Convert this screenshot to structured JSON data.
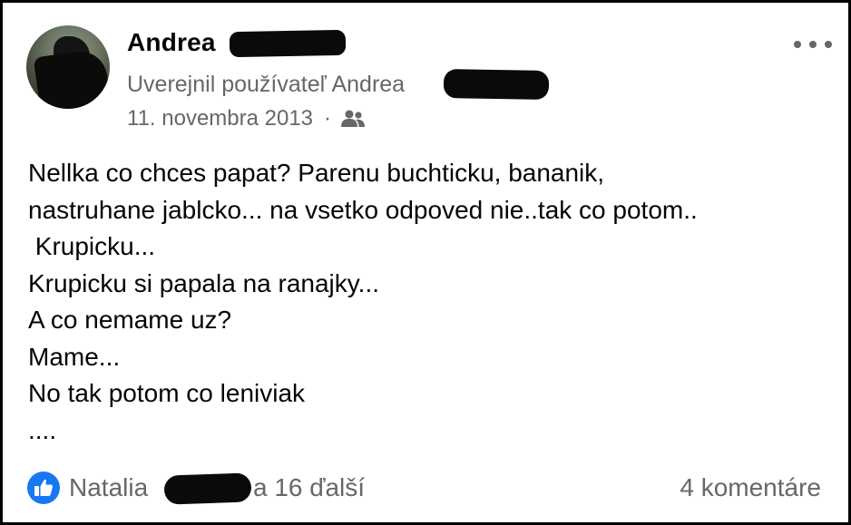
{
  "post": {
    "author_first_name": "Andrea",
    "posted_by_prefix": "Uverejnil používateľ Andrea",
    "date": "11. novembra 2013",
    "separator": "·",
    "audience_icon": "friends-icon",
    "more_icon": "more-options-icon",
    "body_lines": [
      "Nellka co chces papat? Parenu buchticku, bananik,",
      "nastruhane jablcko... na vsetko odpoved nie..tak co potom..",
      " Krupicku...",
      "Krupicku si papala na ranajky...",
      "A co nemame uz?",
      "Mame...",
      "No tak potom co leniviak",
      "...."
    ]
  },
  "footer": {
    "reaction_icon": "like-icon",
    "reaction_name": "Natalia",
    "reaction_suffix": "a 16 ďalší",
    "comments_label": "4 komentáre"
  },
  "colors": {
    "secondary_text": "#65676b",
    "primary_text": "#050505",
    "like_blue": "#1877f2"
  }
}
